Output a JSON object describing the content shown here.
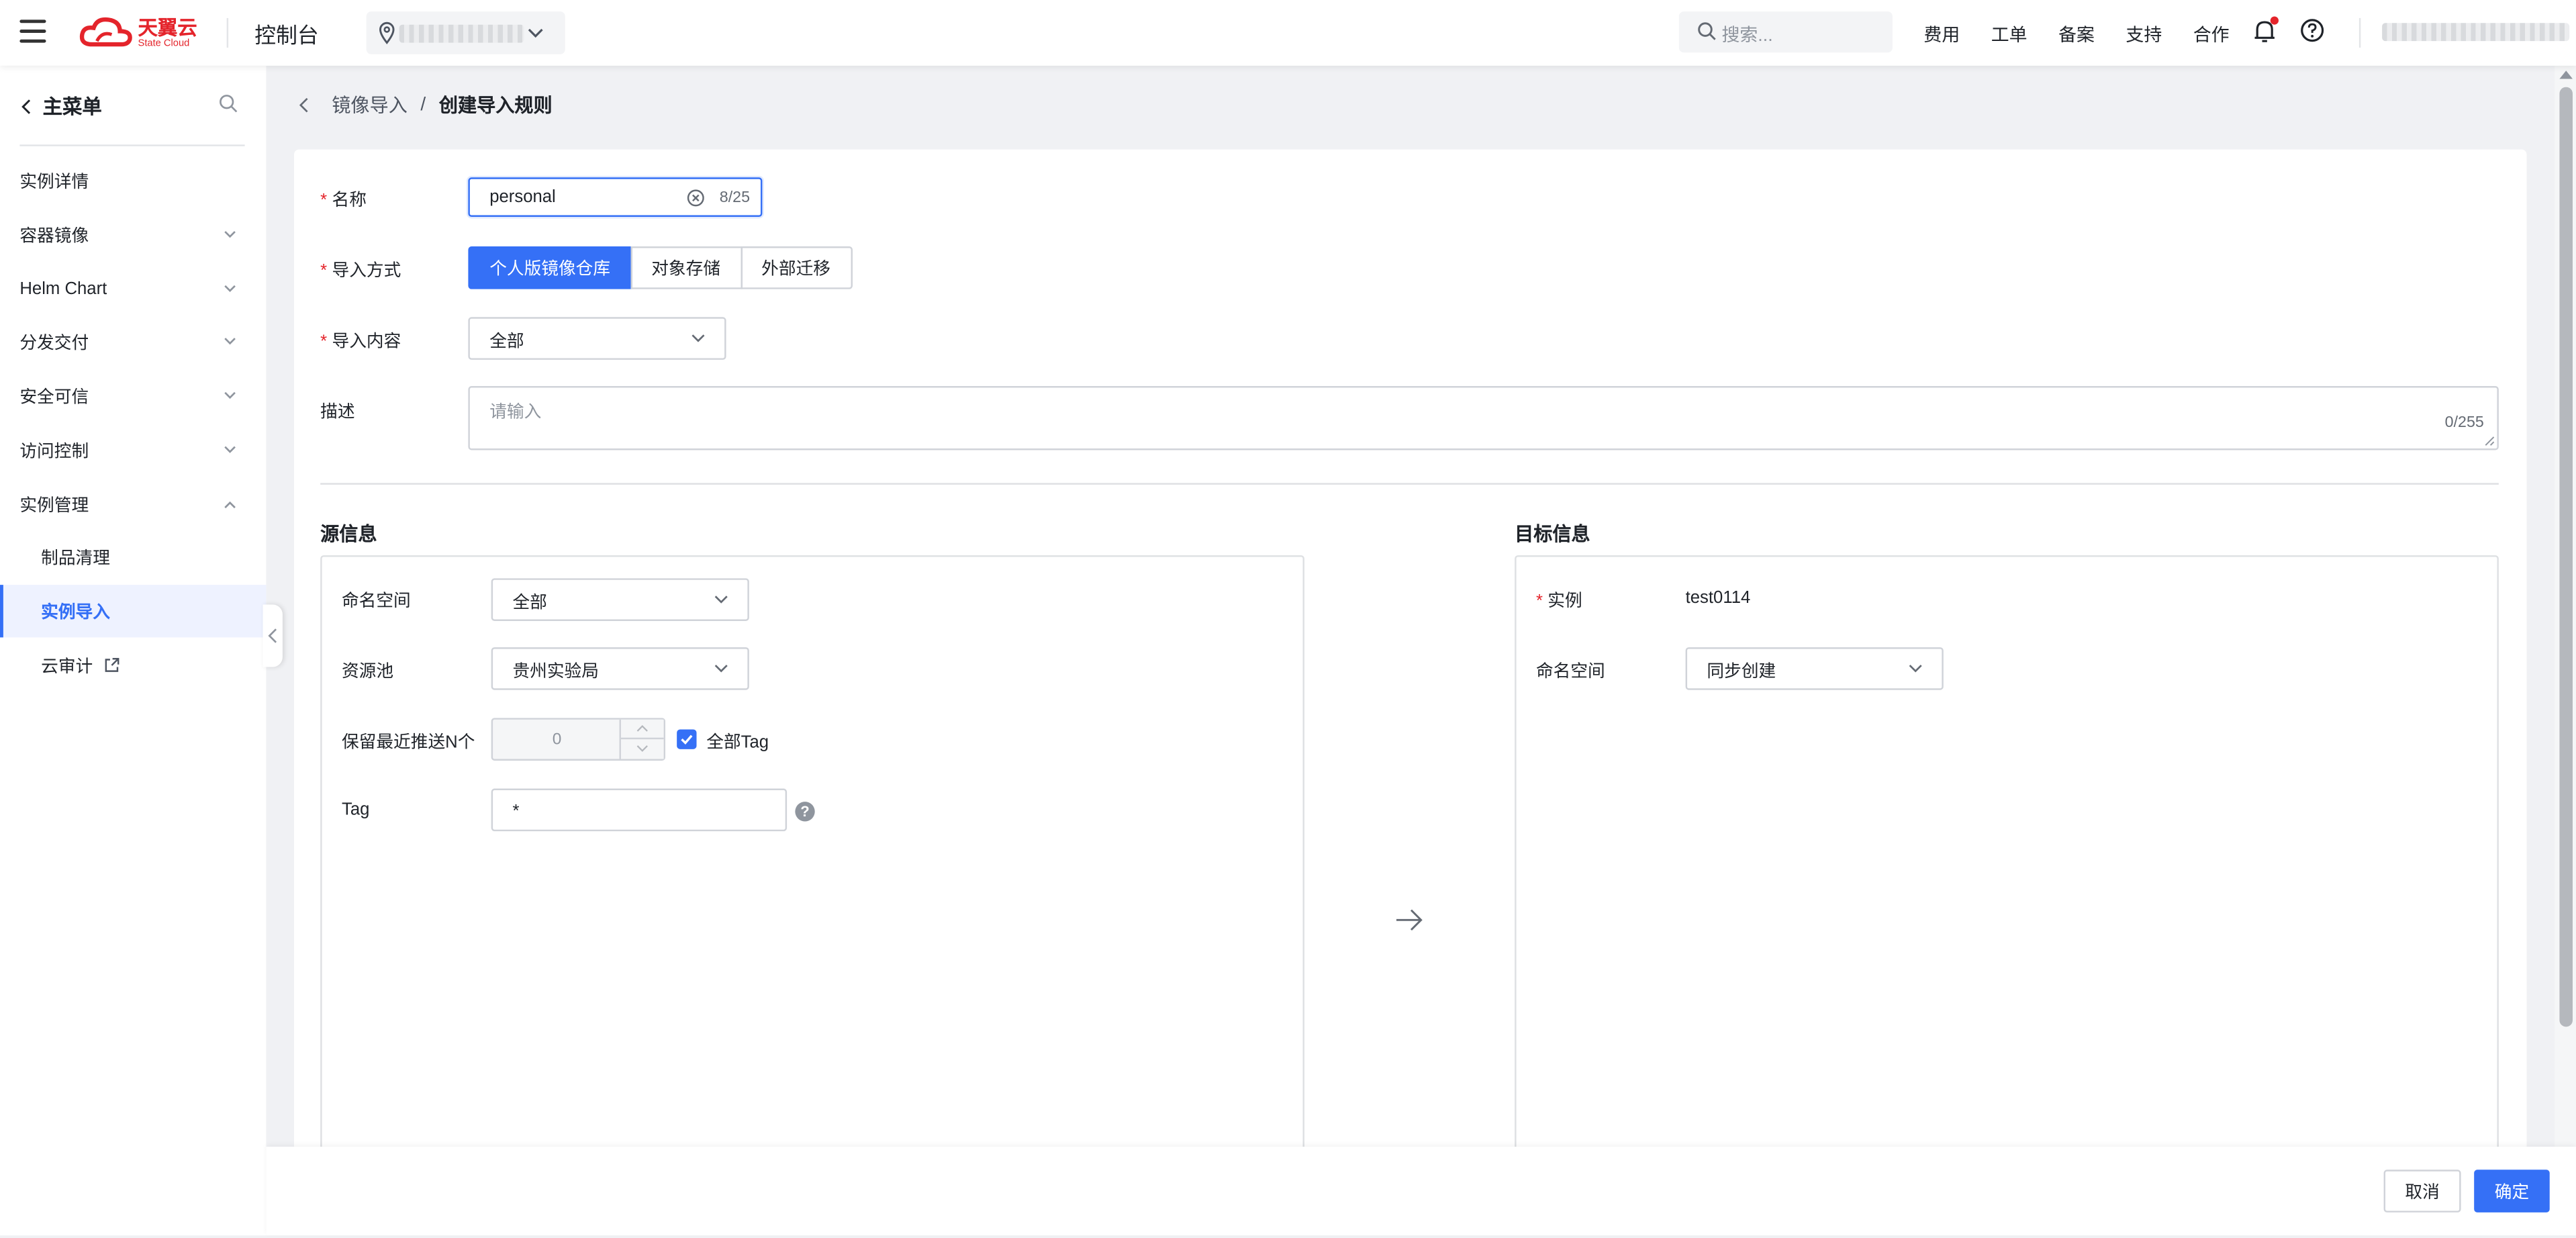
{
  "header": {
    "logo_cn": "天翼云",
    "logo_en": "State Cloud",
    "console": "控制台",
    "search_placeholder": "搜索...",
    "links": [
      "费用",
      "工单",
      "备案",
      "支持",
      "合作"
    ]
  },
  "sidebar": {
    "title": "主菜单",
    "items": [
      {
        "label": "实例详情"
      },
      {
        "label": "容器镜像"
      },
      {
        "label": "Helm Chart"
      },
      {
        "label": "分发交付"
      },
      {
        "label": "安全可信"
      },
      {
        "label": "访问控制"
      },
      {
        "label": "实例管理"
      },
      {
        "label": "制品清理"
      },
      {
        "label": "实例导入"
      },
      {
        "label": "云审计"
      }
    ]
  },
  "breadcrumb": {
    "parent": "镜像导入",
    "separator": "/",
    "current": "创建导入规则"
  },
  "form": {
    "name_label": "名称",
    "name_value": "personal",
    "name_count": "8/25",
    "method_label": "导入方式",
    "methods": [
      "个人版镜像仓库",
      "对象存储",
      "外部迁移"
    ],
    "content_label": "导入内容",
    "content_value": "全部",
    "desc_label": "描述",
    "desc_placeholder": "请输入",
    "desc_count": "0/255"
  },
  "source": {
    "title": "源信息",
    "ns_label": "命名空间",
    "ns_value": "全部",
    "pool_label": "资源池",
    "pool_value": "贵州实验局",
    "keep_label": "保留最近推送N个",
    "keep_value": "0",
    "all_tag_label": "全部Tag",
    "tag_label": "Tag",
    "tag_value": "*"
  },
  "target": {
    "title": "目标信息",
    "instance_label": "实例",
    "instance_value": "test0114",
    "ns_label": "命名空间",
    "ns_value": "同步创建"
  },
  "footer": {
    "cancel": "取消",
    "ok": "确定"
  },
  "colors": {
    "accent": "#3570f6",
    "brand": "#e4242b",
    "required": "#e4242b"
  }
}
